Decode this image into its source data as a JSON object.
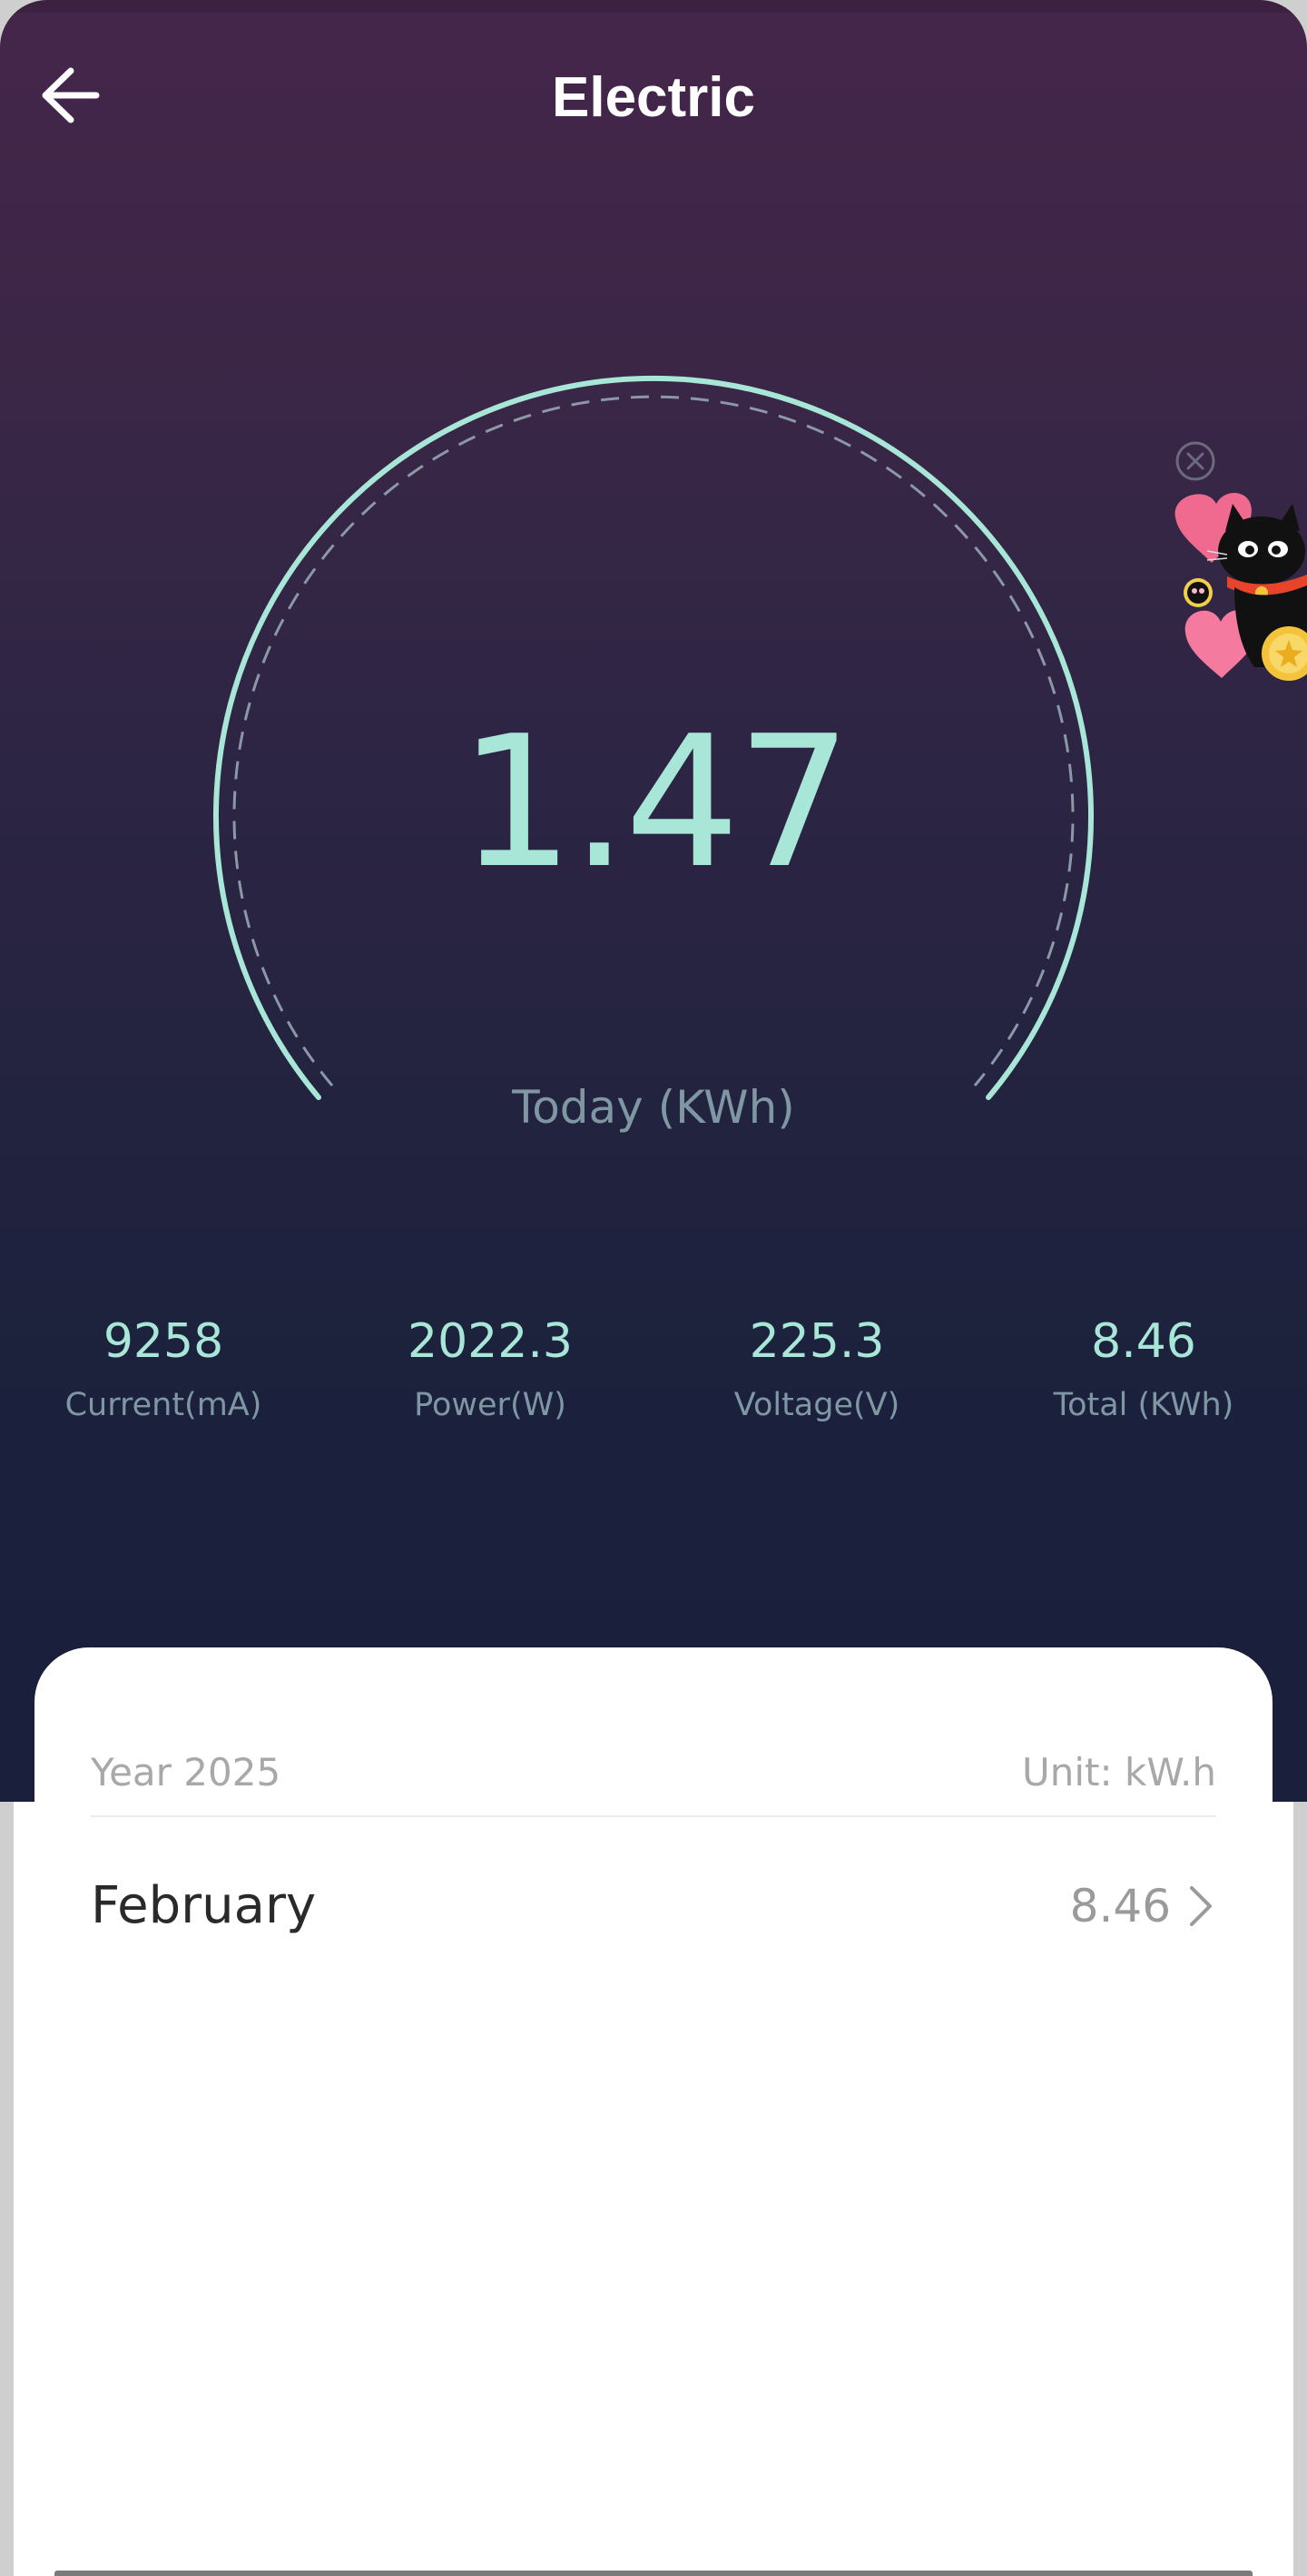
{
  "header": {
    "title": "Electric"
  },
  "gauge": {
    "value": "1.47",
    "label": "Today (KWh)"
  },
  "stats": [
    {
      "value": "9258",
      "label": "Current(mA)"
    },
    {
      "value": "2022.3",
      "label": "Power(W)"
    },
    {
      "value": "225.3",
      "label": "Voltage(V)"
    },
    {
      "value": "8.46",
      "label": "Total (KWh)"
    }
  ],
  "card": {
    "year": "Year 2025",
    "unit": "Unit: kW.h",
    "rows": [
      {
        "month": "February",
        "value": "8.46"
      }
    ]
  },
  "colors": {
    "accent": "#a8e6d7",
    "muted_text": "#7f97a3",
    "hero_top": "#45264a",
    "hero_bottom": "#1a1f3b"
  }
}
